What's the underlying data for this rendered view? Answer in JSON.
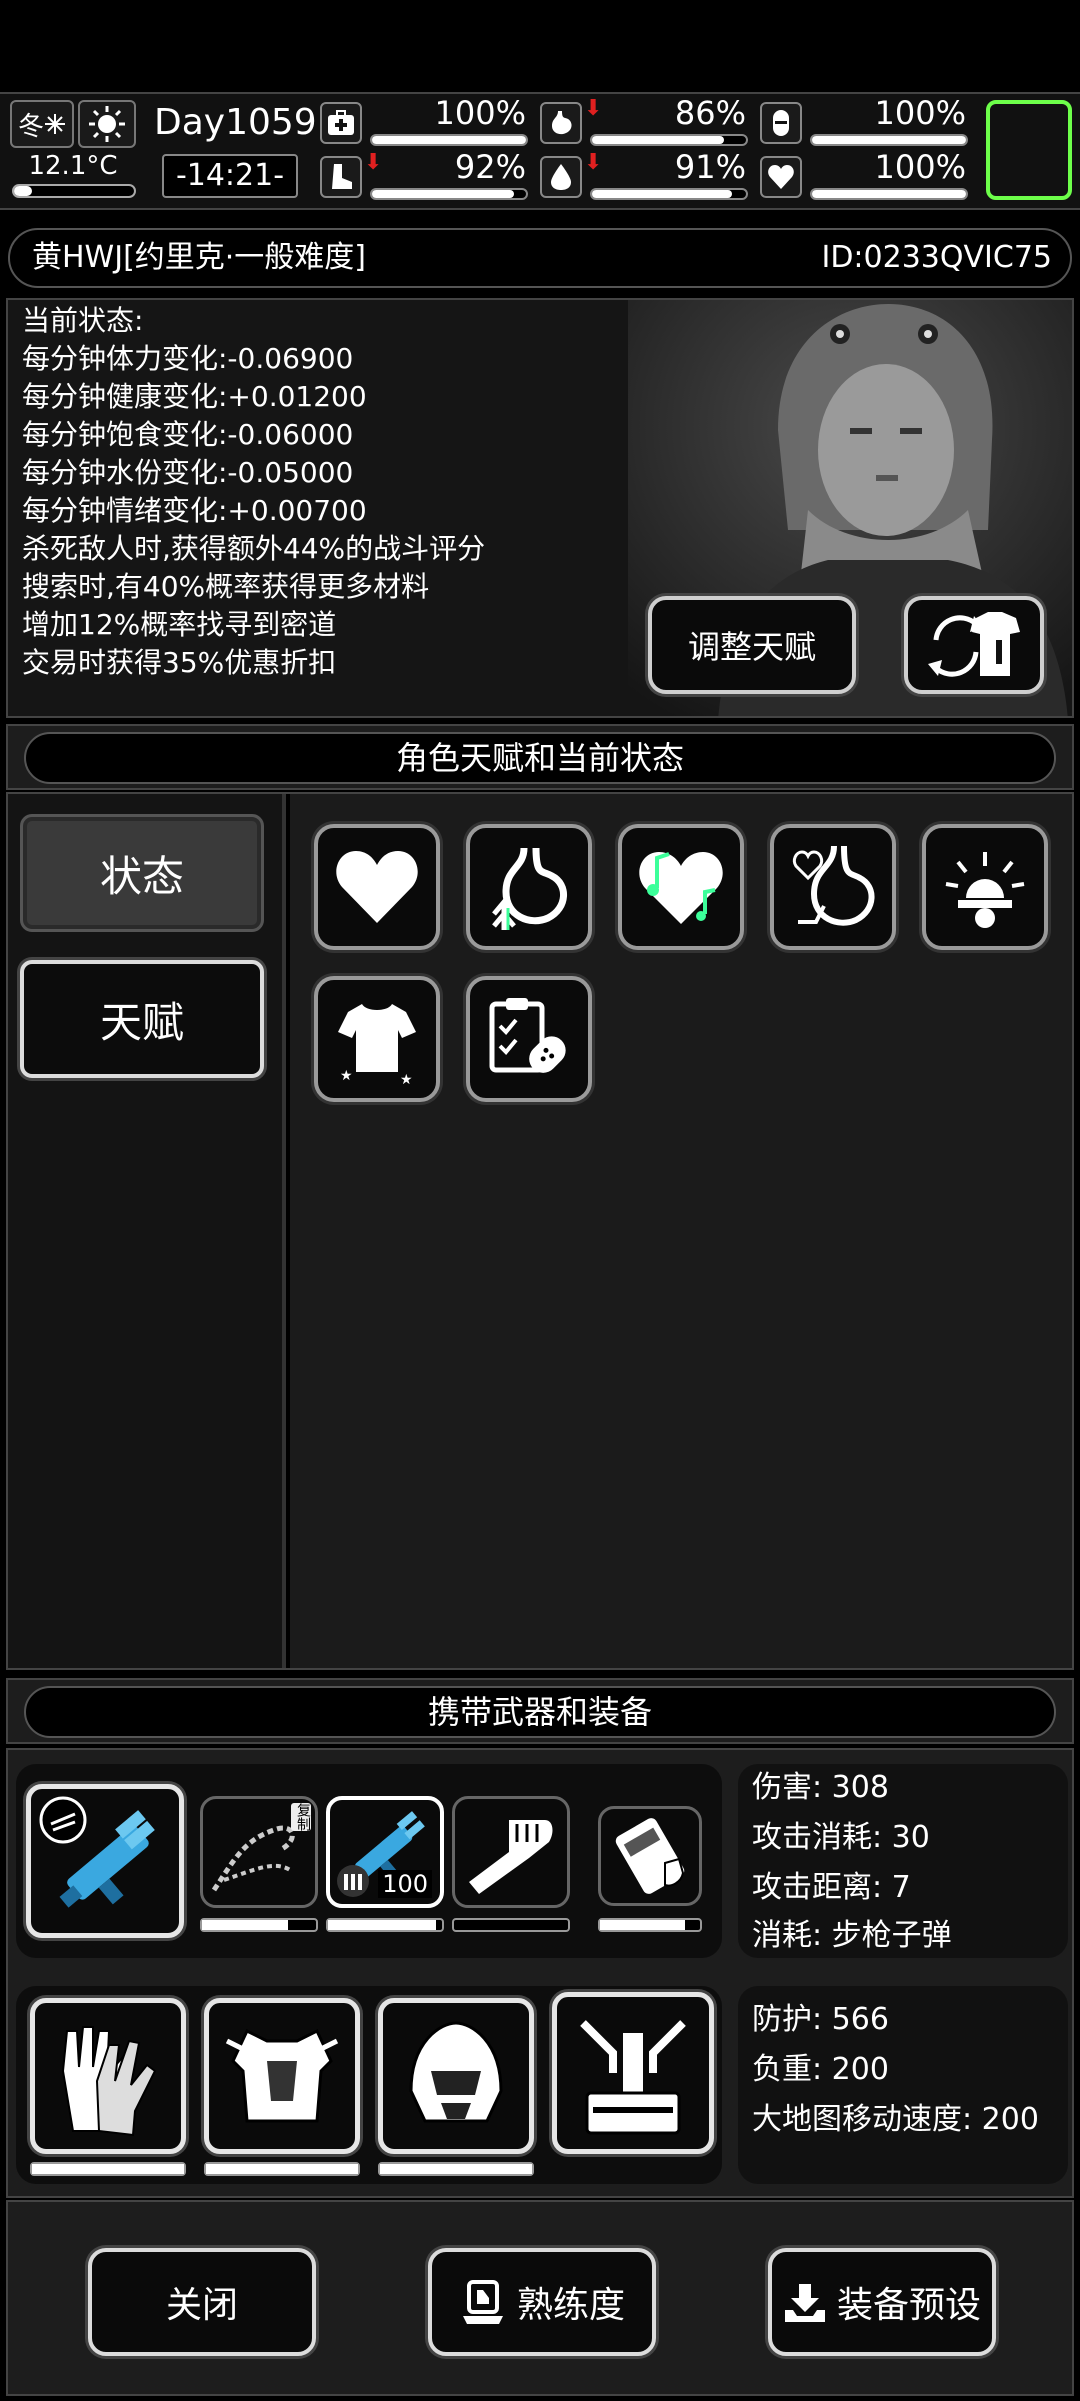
{
  "topbar": {
    "season": "冬",
    "temperature": "12.1°C",
    "temperature_level": 0.15,
    "day": "Day1059",
    "time": "-14:21-",
    "stats": [
      {
        "name": "medical",
        "icon": "medkit-icon",
        "value": "100%",
        "level": 1.0,
        "down": false
      },
      {
        "name": "satiety",
        "icon": "stomach-icon",
        "value": "86%",
        "level": 0.86,
        "down": true
      },
      {
        "name": "armor",
        "icon": "capsule-icon",
        "value": "100%",
        "level": 1.0,
        "down": false
      },
      {
        "name": "stamina",
        "icon": "boot-icon",
        "value": "92%",
        "level": 0.92,
        "down": true
      },
      {
        "name": "water",
        "icon": "water-drop-icon",
        "value": "91%",
        "level": 0.91,
        "down": true
      },
      {
        "name": "mood",
        "icon": "heart-icon",
        "value": "100%",
        "level": 1.0,
        "down": false
      }
    ],
    "accent": "#6dff4a"
  },
  "character": {
    "name": "黄HWJ[约里克·一般难度]",
    "id": "ID:0233QVIC75"
  },
  "status": {
    "lines": [
      "当前状态:",
      "每分钟体力变化:-0.06900",
      "每分钟健康变化:+0.01200",
      "每分钟饱食变化:-0.06000",
      "每分钟水份变化:-0.05000",
      "每分钟情绪变化:+0.00700",
      "杀死敌人时,获得额外44%的战斗评分",
      "搜索时,有40%概率获得更多材料",
      "增加12%概率找寻到密道",
      "交易时获得35%优惠折扣"
    ],
    "adjust_talent_label": "调整天赋"
  },
  "sections": {
    "talent_title": "角色天赋和当前状态",
    "equip_title": "携带武器和装备"
  },
  "sidebar": {
    "tab_status": "状态",
    "tab_talent": "天赋"
  },
  "talent_icons": [
    "heart-icon",
    "stomach-arrow-icon",
    "music-heart-icon",
    "heart-stomach-icon",
    "alarm-light-icon",
    "shirt-icon",
    "clipboard-pill-icon"
  ],
  "weapons": {
    "slots": [
      {
        "icon": "minigun-icon",
        "durability": 1.0
      },
      {
        "icon": "chain-whip-icon",
        "durability": 0.75
      },
      {
        "icon": "minigun-small-icon",
        "durability": 0.95,
        "count": "100"
      },
      {
        "icon": "fist-icon",
        "durability": 0.0
      },
      {
        "icon": "armored-vest-icon",
        "durability": 0.85
      }
    ],
    "badge": "复制",
    "info": [
      "伤害: 308",
      "攻击消耗: 30",
      "攻击距离: 7",
      "消耗: 步枪子弹"
    ]
  },
  "armor": {
    "slots": [
      {
        "icon": "gloves-icon",
        "durability": 1.0
      },
      {
        "icon": "chest-armor-icon",
        "durability": 1.0
      },
      {
        "icon": "helmet-icon",
        "durability": 1.0
      },
      {
        "icon": "backpack-frame-icon",
        "durability": 1.0
      }
    ],
    "info": [
      "防护: 566",
      "负重: 200",
      "大地图移动速度: 200"
    ]
  },
  "buttons": {
    "close": "关闭",
    "proficiency": "熟练度",
    "preset": "装备预设"
  }
}
